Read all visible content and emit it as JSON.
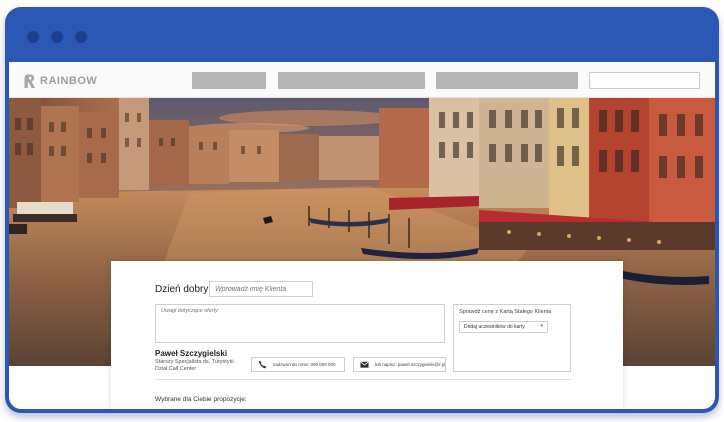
{
  "brand": {
    "name": "RAINBOW"
  },
  "greeting": {
    "label": "Dzień dobry",
    "client_name_placeholder": "Wprowadź imię Klienta"
  },
  "notes": {
    "placeholder": "Uwagi dotyczące oferty"
  },
  "agent": {
    "name": "Paweł Szczygielski",
    "role": "Starszy Specjalista ds. Turystyki",
    "department": "Dział Call Center"
  },
  "contact": {
    "call_label": "zadzwoń do mnie: 000 000 000",
    "email_label": "lub napisz: pawel.szczygielski@r.pl"
  },
  "price_check": {
    "title": "Sprawdź cenę z Kartą Stałego Klienta",
    "select_value": "Dodaj uczestników do karty"
  },
  "proposals": {
    "heading": "Wybrane dla Ciebie propozycje:"
  },
  "colors": {
    "window_frame": "#2a56b4",
    "window_dots": "#1c3f8e",
    "nav_placeholder": "#b4b4b4",
    "logo_gray": "#9c9c9c"
  },
  "icons": {
    "logo": "rainbow-logo-icon",
    "phone": "phone-icon",
    "email": "envelope-icon",
    "dropdown": "chevron-down-icon"
  }
}
